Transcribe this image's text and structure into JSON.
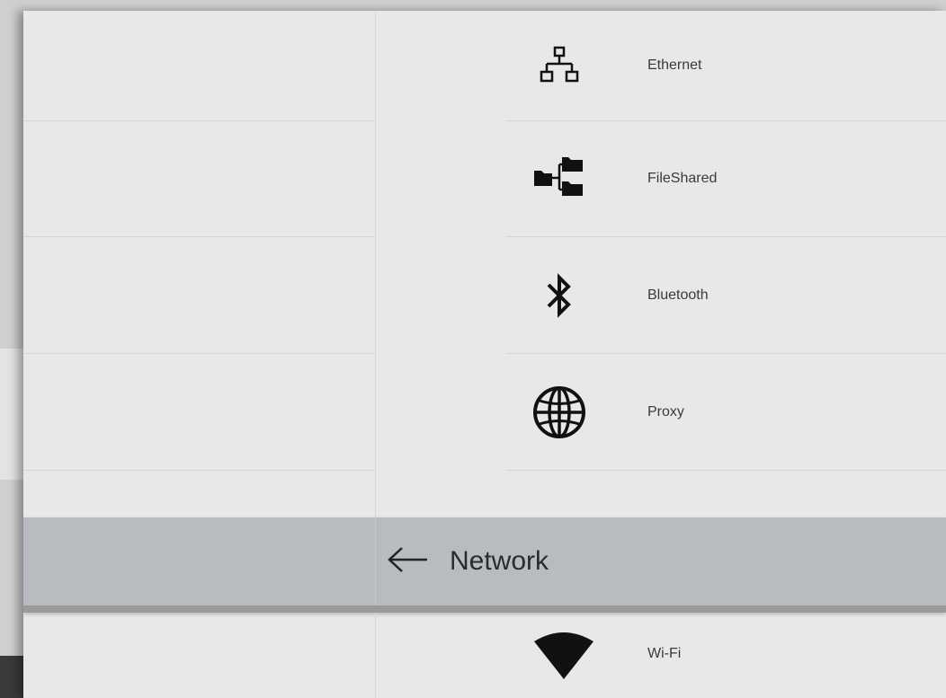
{
  "header": {
    "title": "Network",
    "back_icon": "arrow-left-icon"
  },
  "menu": {
    "items": [
      {
        "label": "Ethernet",
        "icon": "ethernet-icon"
      },
      {
        "label": "FileShared",
        "icon": "file-shared-icon"
      },
      {
        "label": "Bluetooth",
        "icon": "bluetooth-icon"
      },
      {
        "label": "Proxy",
        "icon": "globe-icon"
      }
    ],
    "wifi": {
      "label": "Wi-Fi",
      "icon": "wifi-icon"
    }
  },
  "colors": {
    "panel_bg": "#e8e8e8",
    "header_bg": "#b8bbbf",
    "icon": "#111111"
  }
}
